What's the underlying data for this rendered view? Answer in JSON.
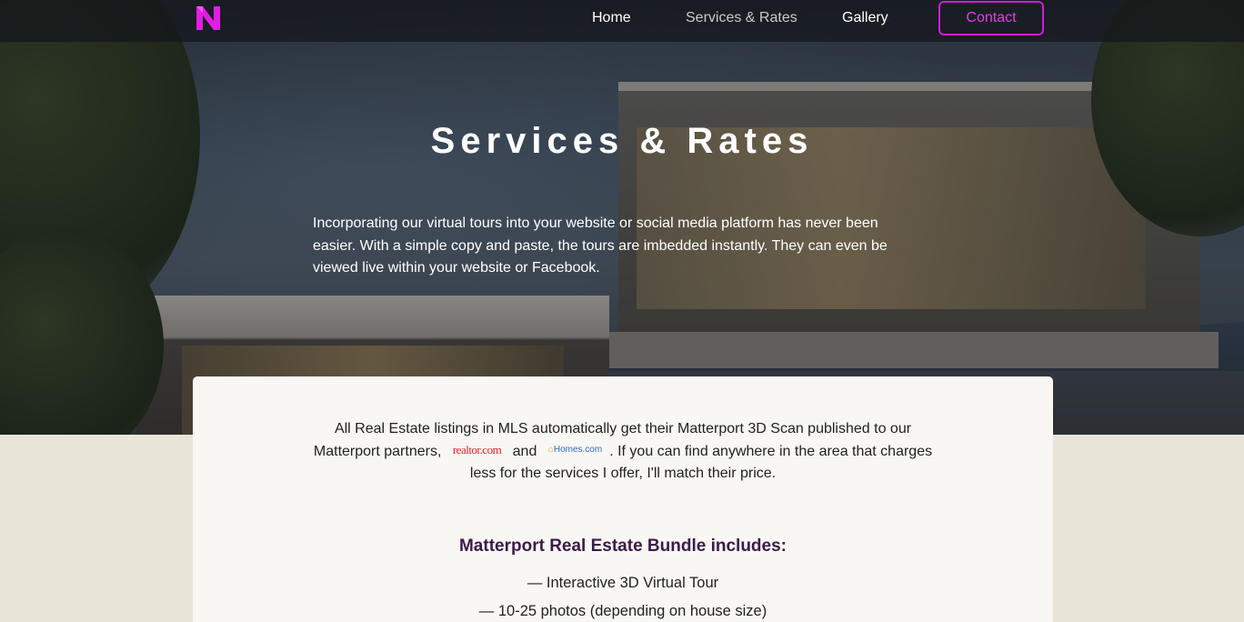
{
  "nav": {
    "logo_icon": "brand-n-logo-icon",
    "links": [
      {
        "label": "Home",
        "active": true
      },
      {
        "label": "Services & Rates",
        "active": false
      },
      {
        "label": "Gallery",
        "active": true
      }
    ],
    "contact_label": "Contact"
  },
  "hero": {
    "title": "Services & Rates",
    "text": "Incorporating our virtual tours into your website or social media platform has never been easier. With a simple copy and paste, the tours are imbedded instantly. They can even be viewed live within your website or Facebook."
  },
  "card": {
    "intro_part1": "All Real Estate listings in MLS automatically get their Matterport 3D Scan published to our Matterport partners,",
    "partner1": "realtor.com",
    "and_text": "and",
    "partner2": "Homes.com",
    "intro_part2": ". If you can find anywhere in the area that charges less for the services I offer, I'll match their price.",
    "bundle_title": "Matterport Real Estate Bundle includes:",
    "bundle_items": [
      "— Interactive 3D Virtual Tour",
      "— 10-25 photos (depending on house size)"
    ]
  },
  "colors": {
    "accent": "#d21bd9",
    "bundle_title": "#3d1a49",
    "page_bg": "#e9e6d9",
    "card_bg": "#f8f7f3"
  }
}
